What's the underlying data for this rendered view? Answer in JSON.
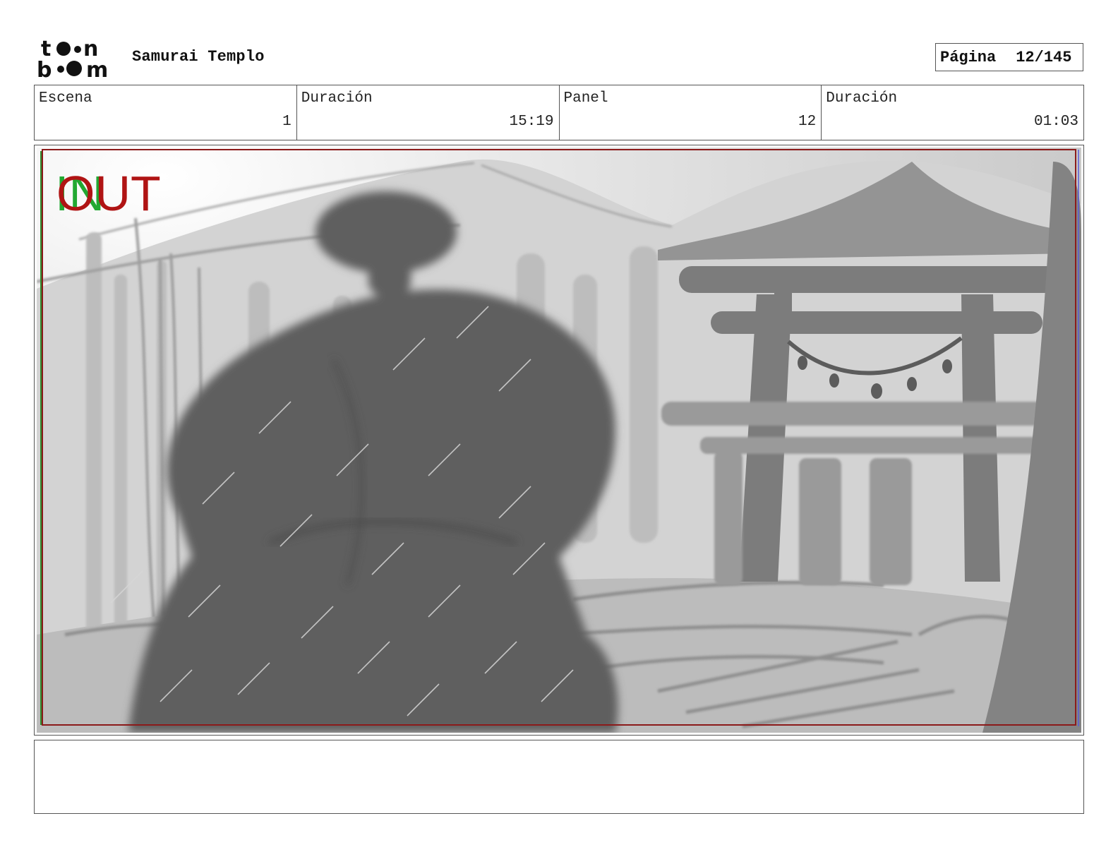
{
  "header": {
    "project_title": "Samurai Templo",
    "logo_text": "toon boom",
    "page_label": "Página",
    "page_number": "12/145"
  },
  "info": {
    "scene_label": "Escena",
    "scene_value": "1",
    "scene_duration_label": "Duración",
    "scene_duration_value": "15:19",
    "panel_label": "Panel",
    "panel_value": "12",
    "panel_duration_label": "Duración",
    "panel_duration_value": "01:03"
  },
  "panel": {
    "in_marker": "IN",
    "out_marker": "OUT",
    "in_color": "#22a832",
    "out_color": "#b01414",
    "safe_frame_color": "#8b1a1a"
  },
  "notes": {
    "text": ""
  }
}
